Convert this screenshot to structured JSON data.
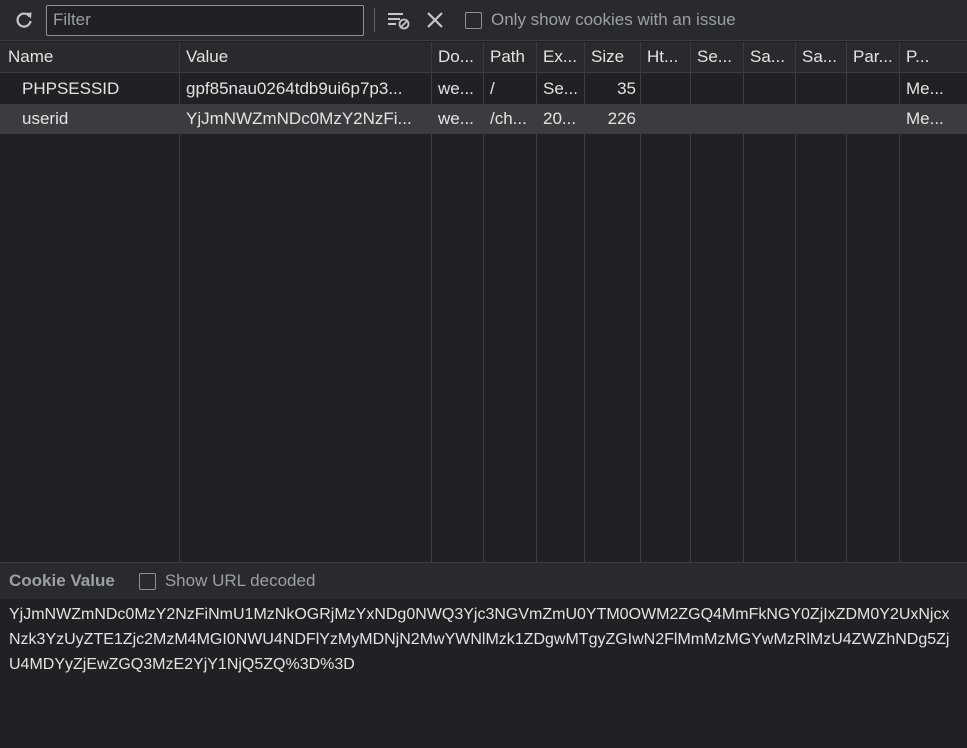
{
  "toolbar": {
    "refresh_icon": "refresh-icon",
    "filter_placeholder": "Filter",
    "filter_value": "",
    "clear_filter_icon": "filter-clear-icon",
    "close_icon": "close-icon",
    "only_issues_label": "Only show cookies with an issue",
    "only_issues_checked": false
  },
  "table": {
    "columns": [
      "Name",
      "Value",
      "Do...",
      "Path",
      "Ex...",
      "Size",
      "Ht...",
      "Se...",
      "Sa...",
      "Sa...",
      "Par...",
      "P..."
    ],
    "rows": [
      {
        "name": "PHPSESSID",
        "value": "gpf85nau0264tdb9ui6p7p3...",
        "domain": "we...",
        "path": "/",
        "expires": "Se...",
        "size": "35",
        "httponly": "",
        "secure": "",
        "samesite": "",
        "sameparty": "",
        "partition": "",
        "priority": "Me...",
        "selected": false
      },
      {
        "name": "userid",
        "value": "YjJmNWZmNDc0MzY2NzFi...",
        "domain": "we...",
        "path": "/ch...",
        "expires": "20...",
        "size": "226",
        "httponly": "",
        "secure": "",
        "samesite": "",
        "sameparty": "",
        "partition": "",
        "priority": "Me...",
        "selected": true
      }
    ]
  },
  "cookie_panel": {
    "title": "Cookie Value",
    "show_decoded_label": "Show URL decoded",
    "show_decoded_checked": false,
    "value": "YjJmNWZmNDc0MzY2NzFiNmU1MzNkOGRjMzYxNDg0NWQ3Yjc3NGVmZmU0YTM0OWM2ZGQ4MmFkNGY0ZjIxZDM0Y2UxNjcxNzk3YzUyZTE1Zjc2MzM4MGI0NWU4NDFlYzMyMDNjN2MwYWNlMzk1ZDgwMTgyZGIwN2FlMmMzMGYwMzRlMzU4ZWZhNDg5ZjU4MDYyZjEwZGQ3MzE2YjY1NjQ5ZQ%3D%3D"
  },
  "colors": {
    "background": "#202124",
    "toolbar": "#292a2d",
    "selected_row": "#3b3c3f",
    "border": "#3c3d40",
    "text": "#e3e3e3",
    "muted_text": "#9aa0a6"
  }
}
